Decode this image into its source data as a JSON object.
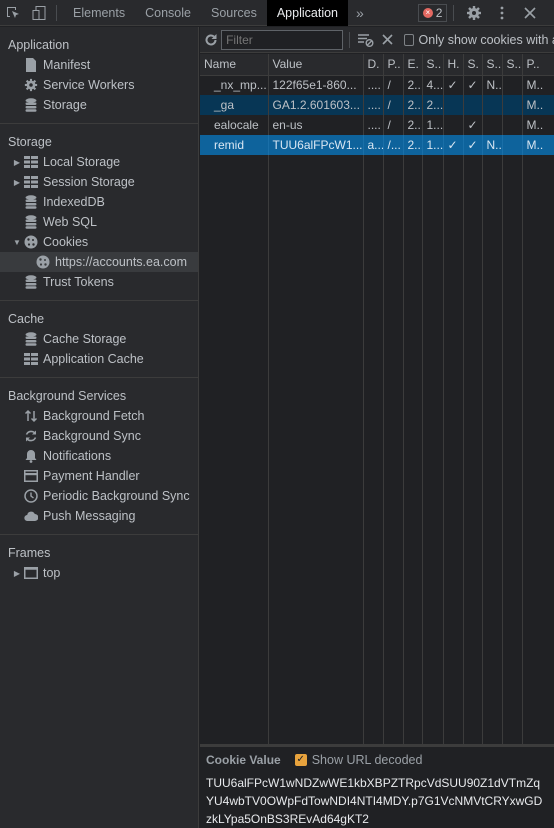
{
  "topbar": {
    "tabs": [
      "Elements",
      "Console",
      "Sources",
      "Application"
    ],
    "active_tab": "Application",
    "more_tabs_glyph": "»",
    "error_count": "2",
    "icons": [
      "inspect-element-icon",
      "device-toolbar-icon",
      "settings-gear-icon",
      "more-vert-icon",
      "close-icon"
    ]
  },
  "sidebar": {
    "sections": [
      {
        "title": "Application",
        "items": [
          {
            "label": "Manifest",
            "icon": "file-icon"
          },
          {
            "label": "Service Workers",
            "icon": "gear-icon"
          },
          {
            "label": "Storage",
            "icon": "database-icon"
          }
        ]
      },
      {
        "title": "Storage",
        "items": [
          {
            "label": "Local Storage",
            "icon": "grid-icon",
            "expandable": true
          },
          {
            "label": "Session Storage",
            "icon": "grid-icon",
            "expandable": true
          },
          {
            "label": "IndexedDB",
            "icon": "database-icon"
          },
          {
            "label": "Web SQL",
            "icon": "database-icon"
          },
          {
            "label": "Cookies",
            "icon": "cookie-icon",
            "expanded": true
          },
          {
            "label": "https://accounts.ea.com",
            "icon": "cookie-icon",
            "selected": true
          },
          {
            "label": "Trust Tokens",
            "icon": "database-icon"
          }
        ]
      },
      {
        "title": "Cache",
        "items": [
          {
            "label": "Cache Storage",
            "icon": "database-icon"
          },
          {
            "label": "Application Cache",
            "icon": "grid-icon"
          }
        ]
      },
      {
        "title": "Background Services",
        "items": [
          {
            "label": "Background Fetch",
            "icon": "up-down-arrows-icon"
          },
          {
            "label": "Background Sync",
            "icon": "sync-icon"
          },
          {
            "label": "Notifications",
            "icon": "bell-icon"
          },
          {
            "label": "Payment Handler",
            "icon": "credit-card-icon"
          },
          {
            "label": "Periodic Background Sync",
            "icon": "clock-icon"
          },
          {
            "label": "Push Messaging",
            "icon": "cloud-icon"
          }
        ]
      },
      {
        "title": "Frames",
        "items": [
          {
            "label": "top",
            "icon": "frame-icon",
            "expandable": true
          }
        ]
      }
    ]
  },
  "toolbar": {
    "filter_placeholder": "Filter",
    "only_show_label": "Only show cookies with an issue"
  },
  "cookies_table": {
    "columns": [
      "Name",
      "Value",
      "D.",
      "P..",
      "E.",
      "S..",
      "H.",
      "S.",
      "S..",
      "S..",
      "P.."
    ],
    "rows": [
      [
        "_nx_mp...",
        "122f65e1-860...",
        "....",
        "/",
        "2...",
        "4...",
        "✓",
        "✓",
        "N...",
        "",
        "M.."
      ],
      [
        "_ga",
        "GA1.2.601603...",
        "....",
        "/",
        "2...",
        "2...",
        "",
        "",
        "",
        "",
        "M.."
      ],
      [
        "ealocale",
        "en-us",
        "....",
        "/",
        "2...",
        "1...",
        "",
        "✓",
        "",
        "",
        "M.."
      ],
      [
        "remid",
        "TUU6alFPcW1...",
        "a...",
        "/...",
        "2...",
        "1...",
        "✓",
        "✓",
        "N...",
        "",
        "M.."
      ]
    ],
    "selected_row": 3,
    "dim_selected_row": 1
  },
  "cookie_value": {
    "title": "Cookie Value",
    "show_decoded_label": "Show URL decoded",
    "show_decoded_checked": true,
    "value": "TUU6alFPcW1wNDZwWE1kbXBPZTRpcVdSUU90Z1dVTmZqYU4wbTV0OWpFdTowNDI4NTI4MDY.p7G1VcNMVtCRYxwGDzkLYpa5OnBS3REvAd64gKT2"
  },
  "colors": {
    "accent_selected_row": "#0e639c",
    "dim_selected_row": "#073655",
    "error_badge": "#e46962",
    "checkbox_checked": "#e8a33d"
  }
}
